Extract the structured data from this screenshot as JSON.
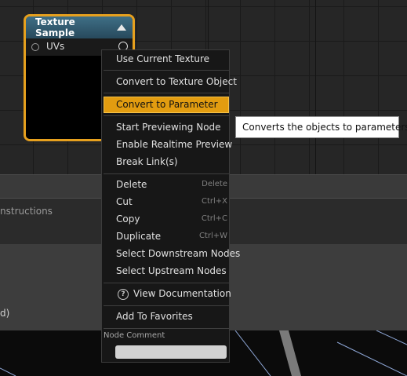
{
  "graph": {
    "node": {
      "title": "Texture Sample",
      "pin_label": "UVs"
    }
  },
  "panels": {
    "band_text": "nstructions",
    "main_text": "d)"
  },
  "context_menu": {
    "use_current": "Use Current Texture",
    "convert_object": "Convert to Texture Object",
    "convert_param": "Convert to Parameter",
    "start_preview": "Start Previewing Node",
    "realtime_preview": "Enable Realtime Preview",
    "break_links": "Break Link(s)",
    "delete": {
      "label": "Delete",
      "shortcut": "Delete"
    },
    "cut": {
      "label": "Cut",
      "shortcut": "Ctrl+X"
    },
    "copy": {
      "label": "Copy",
      "shortcut": "Ctrl+C"
    },
    "duplicate": {
      "label": "Duplicate",
      "shortcut": "Ctrl+W"
    },
    "select_downstream": "Select Downstream Nodes",
    "select_upstream": "Select Upstream Nodes",
    "view_docs": "View Documentation",
    "add_favorites": "Add To Favorites",
    "node_comment_label": "Node Comment",
    "node_comment_value": ""
  },
  "tooltip": "Converts the objects to parameters.",
  "colors": {
    "highlight": "#e29c10",
    "node_border": "#e6a01e",
    "node_header": "#3f6f86"
  }
}
